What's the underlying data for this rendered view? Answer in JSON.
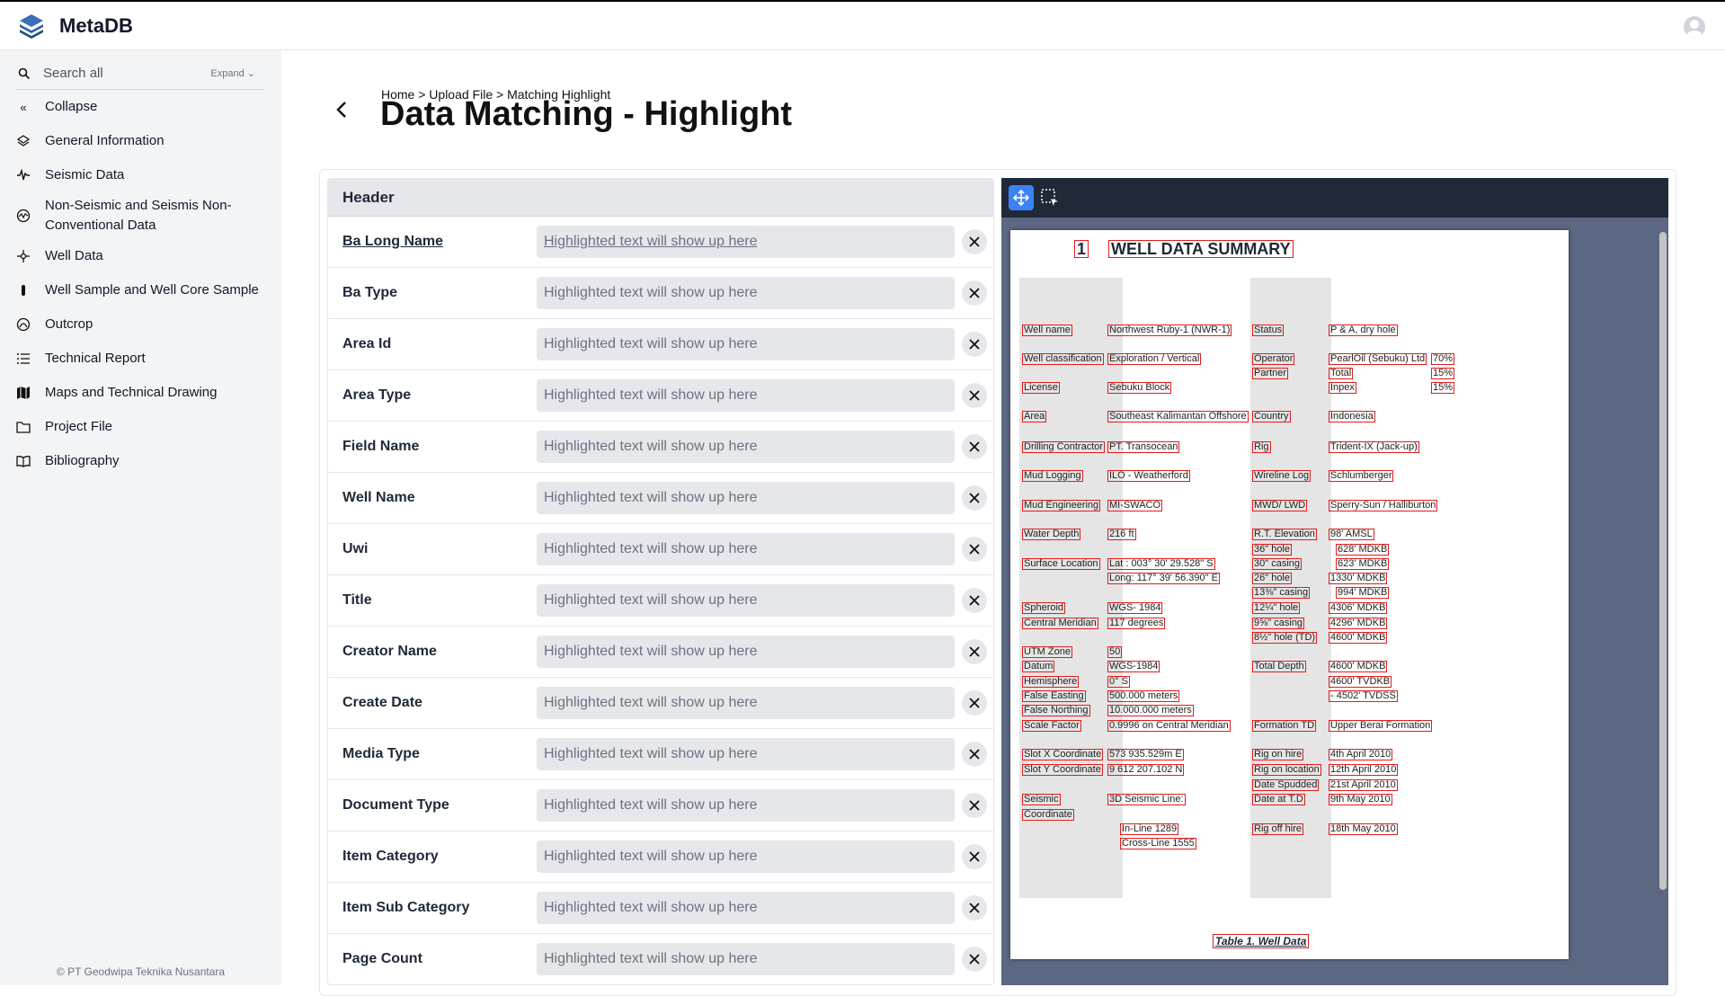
{
  "app": {
    "brand": "MetaDB"
  },
  "sidebar": {
    "search_placeholder": "Search all",
    "expand_label": "Expand",
    "items": [
      {
        "label": "Collapse",
        "icon": "chevrons-left-icon"
      },
      {
        "label": "General Information",
        "icon": "layers-icon"
      },
      {
        "label": "Seismic Data",
        "icon": "seismic-wave-icon"
      },
      {
        "label": "Non-Seismic and Seismis Non-Conventional Data",
        "icon": "radar-icon"
      },
      {
        "label": "Well Data",
        "icon": "well-icon"
      },
      {
        "label": "Well Sample and Well Core Sample",
        "icon": "core-sample-icon"
      },
      {
        "label": "Outcrop",
        "icon": "outcrop-icon"
      },
      {
        "label": "Technical Report",
        "icon": "list-icon"
      },
      {
        "label": "Maps and Technical Drawing",
        "icon": "map-icon"
      },
      {
        "label": "Project File",
        "icon": "folder-icon"
      },
      {
        "label": "Bibliography",
        "icon": "book-icon"
      }
    ],
    "footer": "© PT Geodwipa Teknika Nusantara"
  },
  "page": {
    "breadcrumb": "Home > Upload File > Matching Highlight",
    "title": "Data Matching - Highlight"
  },
  "form": {
    "header": "Header",
    "placeholder": "Highlighted text will show up here",
    "fields": [
      "Ba Long Name",
      "Ba Type",
      "Area Id",
      "Area Type",
      "Field Name",
      "Well Name",
      "Uwi",
      "Title",
      "Creator Name",
      "Create Date",
      "Media Type",
      "Document Type",
      "Item Category",
      "Item Sub Category",
      "Page Count"
    ]
  },
  "document": {
    "number": "1",
    "title": "WELL DATA SUMMARY",
    "caption": "Table 1.   Well Data",
    "left_labels": [
      "Well name",
      "Well classification",
      "License",
      "Area",
      "Drilling Contractor",
      "Mud Logging",
      "Mud Engineering",
      "Water Depth",
      "Surface Location",
      "Spheroid",
      "Central Meridian",
      "UTM Zone",
      "Datum",
      "Hemisphere",
      "False Easting",
      "False Northing",
      "Scale Factor",
      "Slot X Coordinate",
      "Slot Y Coordinate",
      "Seismic",
      "Coordinate"
    ],
    "left_values": [
      "Northwest Ruby-1 (NWR-1)",
      "Exploration / Vertical",
      "Sebuku Block",
      "Southeast Kalimantan Offshore",
      "PT. Transocean",
      "ILO - Weatherford",
      "MI-SWACO",
      "216 ft",
      "Lat  : 003° 30' 29.528\" S",
      "Long: 117° 39' 56.390\" E",
      "WGS- 1984",
      "117 degrees",
      "50",
      "WGS-1984",
      "0° S",
      "500.000 meters",
      "10.000.000 meters",
      "0.9996 on Central Meridian",
      "573 935.529m E",
      "9 612 207.102 N",
      "3D Seismic Line:",
      "In-Line 1289",
      "Cross-Line 1555"
    ],
    "right_labels": [
      "Status",
      "Operator",
      "Partner",
      "Country",
      "Rig",
      "Wireline Log",
      "MWD/ LWD",
      "R.T. Elevation",
      "36\" hole",
      "30\" casing",
      "26\" hole",
      "13⅜\" casing",
      "12¼\" hole",
      "9⅝\" casing",
      "8½\" hole (TD)",
      "Total Depth",
      "Formation TD",
      "Rig on hire",
      "Rig on location",
      "Date Spudded",
      "Date at T.D",
      "Rig off hire"
    ],
    "right_values": [
      "P & A, dry hole",
      "PearlOil (Sebuku) Ltd",
      "Total",
      "Inpex",
      "Indonesia",
      "Trident-IX (Jack-up)",
      "Schlumberger",
      "Sperry-Sun / Halliburton",
      "98' AMSL",
      "628' MDKB",
      "623' MDKB",
      "1330' MDKB",
      "994' MDKB",
      "4306' MDKB",
      "4296' MDKB",
      "4600' MDKB",
      "4600' MDKB",
      "4600' TVDKB",
      "- 4502' TVDSS",
      "Upper Berai Formation",
      "4th April 2010",
      "12th April 2010",
      "21st April 2010",
      "9th May 2010",
      "18th May 2010"
    ],
    "percents": [
      "70%",
      "15%",
      "15%"
    ]
  }
}
